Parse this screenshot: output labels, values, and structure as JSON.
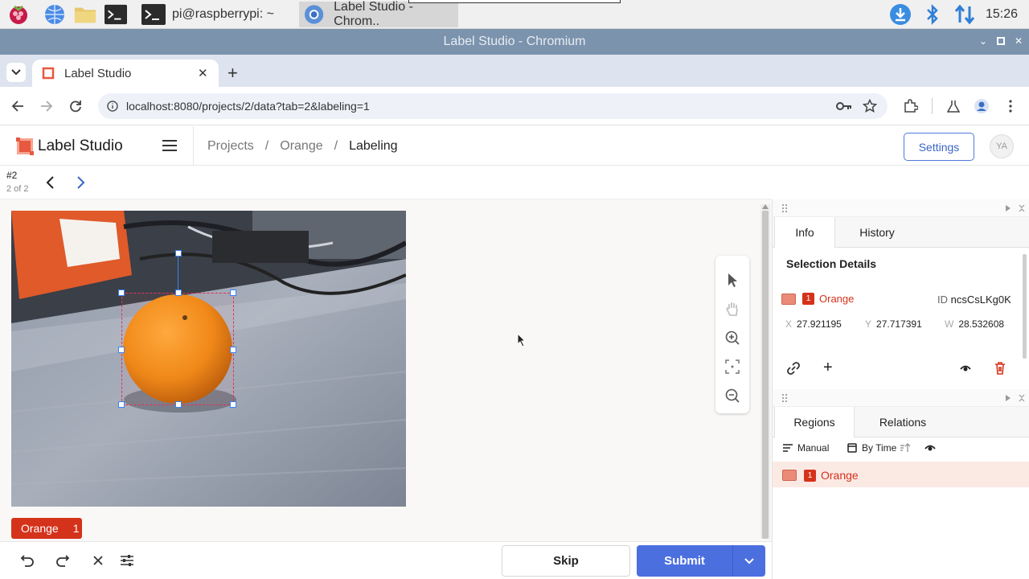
{
  "taskbar": {
    "tasks": [
      {
        "label": "pi@raspberrypi: ~"
      },
      {
        "label": "Label Studio - Chrom.."
      }
    ],
    "clock": "15:26"
  },
  "window": {
    "title": "Label Studio - Chromium"
  },
  "browser": {
    "tab_title": "Label Studio",
    "url": "localhost:8080/projects/2/data?tab=2&labeling=1"
  },
  "app": {
    "brand": "Label Studio",
    "breadcrumbs": [
      "Projects",
      "Orange",
      "Labeling"
    ],
    "settings_label": "Settings",
    "avatar_initials": "YA"
  },
  "task": {
    "id": "#2",
    "position": "2 of 2"
  },
  "labels": [
    {
      "name": "Orange",
      "count": "1"
    }
  ],
  "bottom": {
    "skip_label": "Skip",
    "submit_label": "Submit"
  },
  "panel": {
    "tabs": [
      "Info",
      "History"
    ],
    "section_title": "Selection Details",
    "region": {
      "badge": "1",
      "label": "Orange",
      "id_label": "ID",
      "id_value": "ncsCsLKg0K",
      "x_label": "X",
      "x_value": "27.921195",
      "y_label": "Y",
      "y_value": "27.717391",
      "w_label": "W",
      "w_value": "28.532608"
    },
    "tabs2": [
      "Regions",
      "Relations"
    ],
    "sort": {
      "manual": "Manual",
      "by_time": "By Time"
    },
    "list": [
      {
        "badge": "1",
        "label": "Orange"
      }
    ]
  },
  "colors": {
    "accent": "#4c6fe0",
    "label_orange": "#d5321b",
    "taskbar": "#f0f0f0",
    "titlebar": "#7c93ad"
  }
}
